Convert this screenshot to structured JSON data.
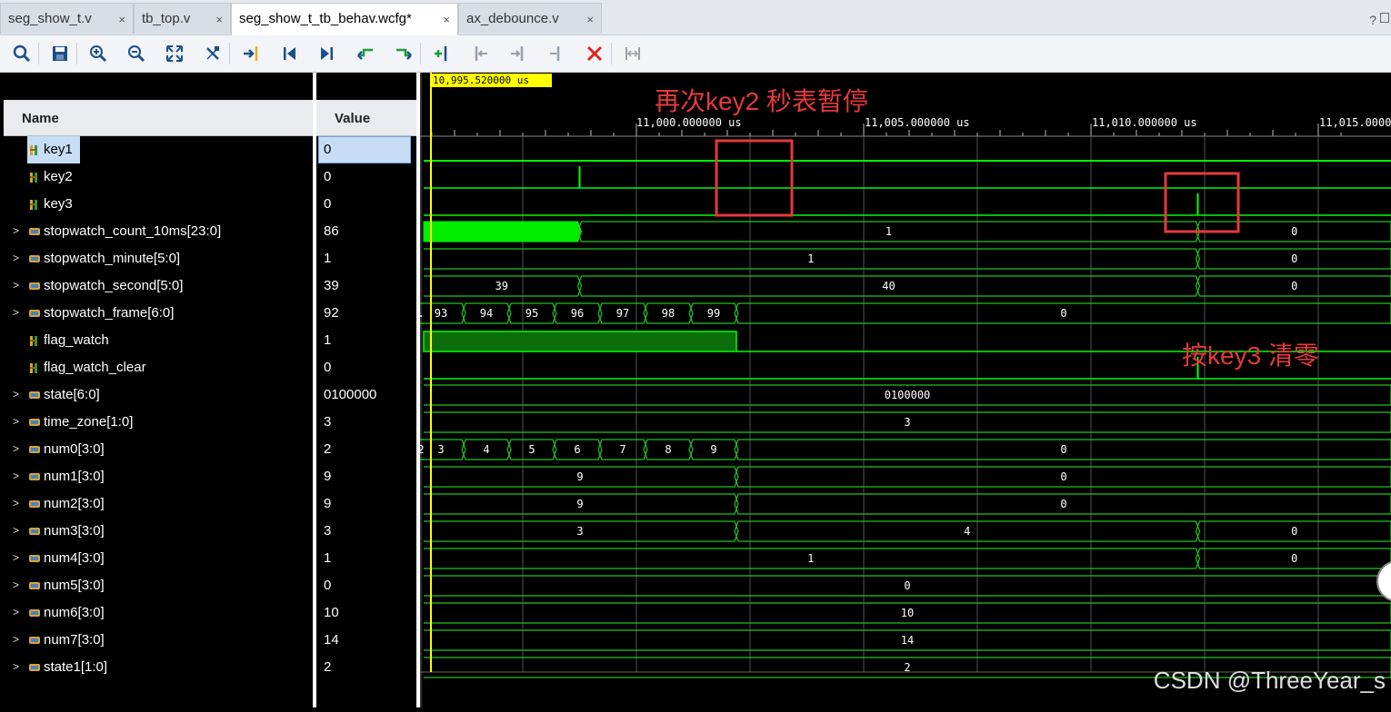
{
  "tabs": [
    {
      "label": "seg_show_t.v",
      "active": false
    },
    {
      "label": "tb_top.v",
      "active": false
    },
    {
      "label": "seg_show_t_tb_behav.wcfg*",
      "active": true
    },
    {
      "label": "ax_debounce.v",
      "active": false
    }
  ],
  "close_glyph": "×",
  "help_glyph": "?",
  "toolbar_icons": [
    "search-icon",
    "save-icon",
    "zoom-in-icon",
    "zoom-out-icon",
    "zoom-fit-icon",
    "cursor-icon",
    "go-to-cursor-icon",
    "go-to-start-icon",
    "go-to-end-icon",
    "previous-transition-icon",
    "next-transition-icon",
    "add-marker-icon",
    "previous-marker-icon",
    "next-marker-icon",
    "swap-cursors-icon",
    "delete-icon",
    "snap-icon"
  ],
  "columns": {
    "name": "Name",
    "value": "Value"
  },
  "cursor_time": "10,995.520000  us",
  "time_ticks": [
    {
      "label": "11,000.000000  us"
    },
    {
      "label": "11,005.000000  us"
    },
    {
      "label": "11,010.000000  us"
    },
    {
      "label": "11,015.000000  us"
    }
  ],
  "signals": [
    {
      "name": "key1",
      "value": "0",
      "kind": "bit",
      "expandable": false,
      "selected": true
    },
    {
      "name": "key2",
      "value": "0",
      "kind": "bit",
      "expandable": false
    },
    {
      "name": "key3",
      "value": "0",
      "kind": "bit",
      "expandable": false
    },
    {
      "name": "stopwatch_count_10ms[23:0]",
      "value": "86",
      "kind": "bus",
      "expandable": true
    },
    {
      "name": "stopwatch_minute[5:0]",
      "value": "1",
      "kind": "bus",
      "expandable": true
    },
    {
      "name": "stopwatch_second[5:0]",
      "value": "39",
      "kind": "bus",
      "expandable": true
    },
    {
      "name": "stopwatch_frame[6:0]",
      "value": "92",
      "kind": "bus",
      "expandable": true
    },
    {
      "name": "flag_watch",
      "value": "1",
      "kind": "bit",
      "expandable": false
    },
    {
      "name": "flag_watch_clear",
      "value": "0",
      "kind": "bit",
      "expandable": false
    },
    {
      "name": "state[6:0]",
      "value": "0100000",
      "kind": "bus",
      "expandable": true
    },
    {
      "name": "time_zone[1:0]",
      "value": "3",
      "kind": "bus",
      "expandable": true
    },
    {
      "name": "num0[3:0]",
      "value": "2",
      "kind": "bus",
      "expandable": true
    },
    {
      "name": "num1[3:0]",
      "value": "9",
      "kind": "bus",
      "expandable": true
    },
    {
      "name": "num2[3:0]",
      "value": "9",
      "kind": "bus",
      "expandable": true
    },
    {
      "name": "num3[3:0]",
      "value": "3",
      "kind": "bus",
      "expandable": true
    },
    {
      "name": "num4[3:0]",
      "value": "1",
      "kind": "bus",
      "expandable": true
    },
    {
      "name": "num5[3:0]",
      "value": "0",
      "kind": "bus",
      "expandable": true
    },
    {
      "name": "num6[3:0]",
      "value": "10",
      "kind": "bus",
      "expandable": true
    },
    {
      "name": "num7[3:0]",
      "value": "14",
      "kind": "bus",
      "expandable": true
    },
    {
      "name": "state1[1:0]",
      "value": "2",
      "kind": "bus",
      "expandable": true
    }
  ],
  "waveforms": {
    "stopwatch_count_10ms": {
      "segments": [
        {
          "to": 10998.75,
          "fill": "solid"
        },
        {
          "label": "1",
          "to": 11012.35
        },
        {
          "label": "0"
        }
      ]
    },
    "stopwatch_minute": {
      "segments": [
        {
          "label": "1",
          "to": 11012.35
        },
        {
          "label": "0"
        }
      ]
    },
    "stopwatch_second": {
      "segments": [
        {
          "label": "39",
          "to": 10998.75
        },
        {
          "label": "40",
          "to": 11012.35
        },
        {
          "label": "0"
        }
      ]
    },
    "stopwatch_frame": {
      "segments": [
        {
          "label": ".",
          "to": 10995.2
        },
        {
          "label": "93",
          "to": 10996.2
        },
        {
          "label": "94",
          "to": 10997.2
        },
        {
          "label": "95",
          "to": 10998.2
        },
        {
          "label": "96",
          "to": 10999.2
        },
        {
          "label": "97",
          "to": 11000.2
        },
        {
          "label": "98",
          "to": 11001.2
        },
        {
          "label": "99",
          "to": 11002.2
        },
        {
          "label": "0"
        }
      ]
    },
    "state": {
      "segments": [
        {
          "label": "0100000"
        }
      ]
    },
    "time_zone": {
      "segments": [
        {
          "label": "3"
        }
      ]
    },
    "num0": {
      "segments": [
        {
          "label": "2",
          "to": 10995.2
        },
        {
          "label": "3",
          "to": 10996.2
        },
        {
          "label": "4",
          "to": 10997.2
        },
        {
          "label": "5",
          "to": 10998.2
        },
        {
          "label": "6",
          "to": 10999.2
        },
        {
          "label": "7",
          "to": 11000.2
        },
        {
          "label": "8",
          "to": 11001.2
        },
        {
          "label": "9",
          "to": 11002.2
        },
        {
          "label": "0"
        }
      ]
    },
    "num1": {
      "segments": [
        {
          "label": "9",
          "to": 11002.2
        },
        {
          "label": "0"
        }
      ]
    },
    "num2": {
      "segments": [
        {
          "label": "9",
          "to": 11002.2
        },
        {
          "label": "0"
        }
      ]
    },
    "num3": {
      "segments": [
        {
          "label": "3",
          "to": 11002.2
        },
        {
          "label": "4",
          "to": 11012.35
        },
        {
          "label": "0"
        }
      ]
    },
    "num4": {
      "segments": [
        {
          "label": "1",
          "to": 11012.35
        },
        {
          "label": "0"
        }
      ]
    },
    "num5": {
      "segments": [
        {
          "label": "0"
        }
      ]
    },
    "num6": {
      "segments": [
        {
          "label": "10"
        }
      ]
    },
    "num7": {
      "segments": [
        {
          "label": "14"
        }
      ]
    },
    "state1": {
      "segments": [
        {
          "label": "2"
        }
      ]
    }
  },
  "annotations": {
    "pause": "再次key2  秒表暂停",
    "clear": "按key3 清零"
  },
  "watermark": "CSDN @ThreeYear_s",
  "colors": {
    "wave_green": "#00ff00",
    "bus_line": "#22c322",
    "grid": "#555555",
    "cursor": "#ffff00",
    "highlight_box": "#e5393b",
    "selection": "#c7ddf5"
  }
}
